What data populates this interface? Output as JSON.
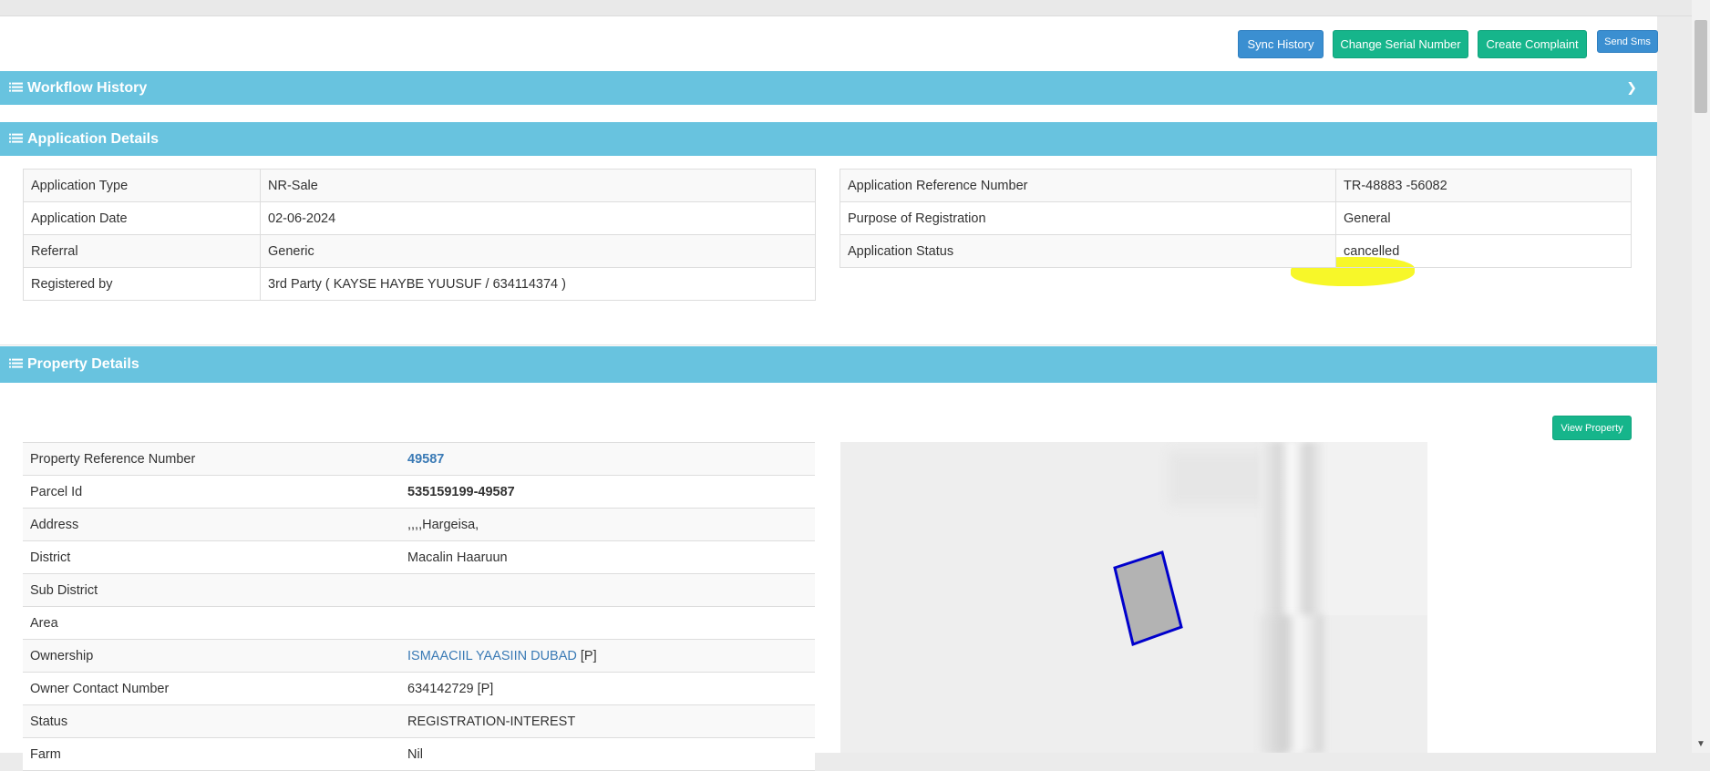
{
  "toolbar": {
    "sync_history": "Sync History",
    "change_serial": "Change Serial Number",
    "create_complaint": "Create Complaint",
    "send_sms": "Send Sms"
  },
  "sections": {
    "workflow_history": "Workflow History",
    "application_details": "Application Details",
    "property_details": "Property Details"
  },
  "application": {
    "left": [
      {
        "label": "Application Type",
        "value": "NR-Sale"
      },
      {
        "label": "Application Date",
        "value": "02-06-2024"
      },
      {
        "label": "Referral",
        "value": "Generic"
      },
      {
        "label": "Registered by",
        "value": "3rd Party ( KAYSE HAYBE YUUSUF / 634114374 )"
      }
    ],
    "right": [
      {
        "label": "Application Reference Number",
        "value": "TR-48883 -56082"
      },
      {
        "label": "Purpose of Registration",
        "value": "General"
      },
      {
        "label": "Application Status",
        "value": "cancelled"
      }
    ]
  },
  "property": {
    "view_property": "View Property",
    "rows": [
      {
        "label": "Property Reference Number",
        "value": "49587"
      },
      {
        "label": "Parcel Id",
        "value": "535159199-49587"
      },
      {
        "label": "Address",
        "value": ",,,,Hargeisa,"
      },
      {
        "label": "District",
        "value": "Macalin Haaruun"
      },
      {
        "label": "Sub District",
        "value": ""
      },
      {
        "label": "Area",
        "value": ""
      },
      {
        "label": "Ownership",
        "value": "ISMAACIIL YAASIIN DUBAD",
        "suffix": "[P]"
      },
      {
        "label": "Owner Contact Number",
        "value": "634142729 [P]"
      },
      {
        "label": "Status",
        "value": "REGISTRATION-INTEREST"
      },
      {
        "label": "Farm",
        "value": "Nil"
      }
    ]
  },
  "colors": {
    "section_header": "#68c3df",
    "button_blue": "#3b8fd1",
    "button_green": "#16b58b",
    "link": "#3a7ab5",
    "status_highlight": "#f7f71e",
    "parcel_outline": "#0000cc"
  },
  "icons": [
    "list-icon",
    "chevron-down-icon"
  ]
}
